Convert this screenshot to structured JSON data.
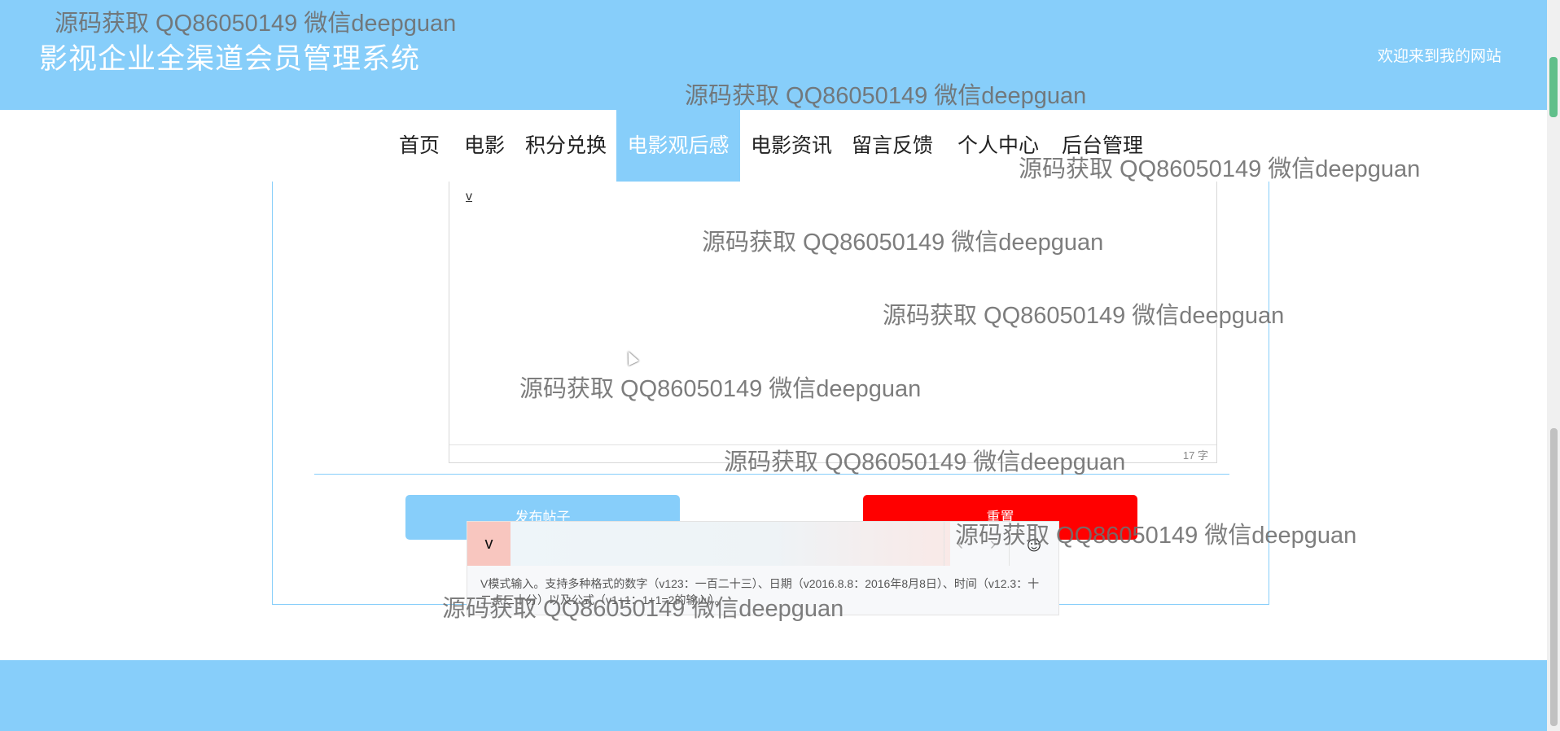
{
  "header": {
    "title": "影视企业全渠道会员管理系统",
    "welcome": "欢迎来到我的网站"
  },
  "nav": {
    "items": [
      {
        "label": "首页"
      },
      {
        "label": "电影"
      },
      {
        "label": "积分兑换"
      },
      {
        "label": "电影观后感",
        "active": true
      },
      {
        "label": "电影资讯"
      },
      {
        "label": "留言反馈"
      },
      {
        "label": "个人中心"
      },
      {
        "label": "后台管理"
      }
    ]
  },
  "editor": {
    "content": "v",
    "word_count": "17 字"
  },
  "buttons": {
    "submit_label": "发布帖子",
    "reset_label": "重置"
  },
  "ime": {
    "mode_label": "v",
    "prev_glyph": "‹",
    "next_glyph": "›",
    "emoji_glyph": "☺",
    "hint": "V模式输入。支持多种格式的数字（v123：一百二十三）、日期（v2016.8.8：2016年8月8日）、时间（v12.3：十二点三十分）以及公式（v1+1：1+1=2的输入）。"
  },
  "watermark": {
    "text": "源码获取 QQ86050149 微信deepguan"
  },
  "colors": {
    "primary": "#87cefa",
    "danger": "#ff0000",
    "ime_mode_bg": "#f8c6bf"
  }
}
